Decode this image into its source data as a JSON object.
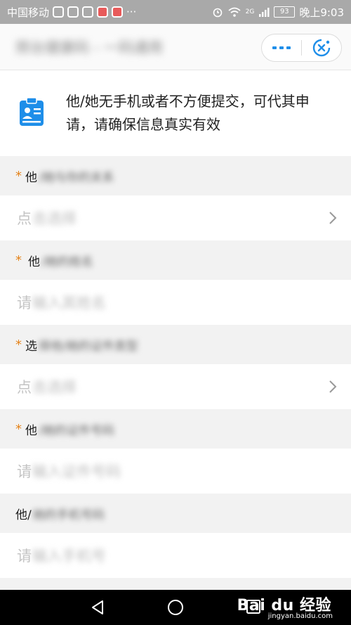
{
  "status_bar": {
    "carrier": "中国移动",
    "more": "···",
    "network": "2G",
    "battery": "93",
    "time": "晚上9:03"
  },
  "title_bar": {
    "title": "邢台健康码 - 一码通用"
  },
  "notice": {
    "text": "他/她无手机或者不方便提交，可代其申请，请确保信息真实有效"
  },
  "form": {
    "fields": [
      {
        "required": "*",
        "label_visible": "他",
        "label_blurred": "/她与你的关系",
        "placeholder_visible": "点",
        "placeholder_blurred": "击选择",
        "has_chevron": true
      },
      {
        "required": "*",
        "label_visible": "他",
        "label_blurred": "/她的姓名",
        "placeholder_visible": "请",
        "placeholder_blurred": "输入其姓名",
        "has_chevron": false
      },
      {
        "required": "*",
        "label_visible": "选",
        "label_blurred": "择他/她的证件类型",
        "placeholder_visible": "点",
        "placeholder_blurred": "击选择",
        "has_chevron": true
      },
      {
        "required": "*",
        "label_visible": "他",
        "label_blurred": "/她的证件号码",
        "placeholder_visible": "请",
        "placeholder_blurred": "输入证件号码",
        "has_chevron": false
      },
      {
        "required": "",
        "label_visible": "他/",
        "label_blurred": "她的手机号码",
        "placeholder_visible": "请",
        "placeholder_blurred": "输入手机号",
        "has_chevron": false
      }
    ]
  },
  "watermark": {
    "brand": "Bai du 经验",
    "url": "jingyan.baidu.com"
  },
  "colors": {
    "accent_blue": "#1e8ee9",
    "required_orange": "#e4831a"
  }
}
